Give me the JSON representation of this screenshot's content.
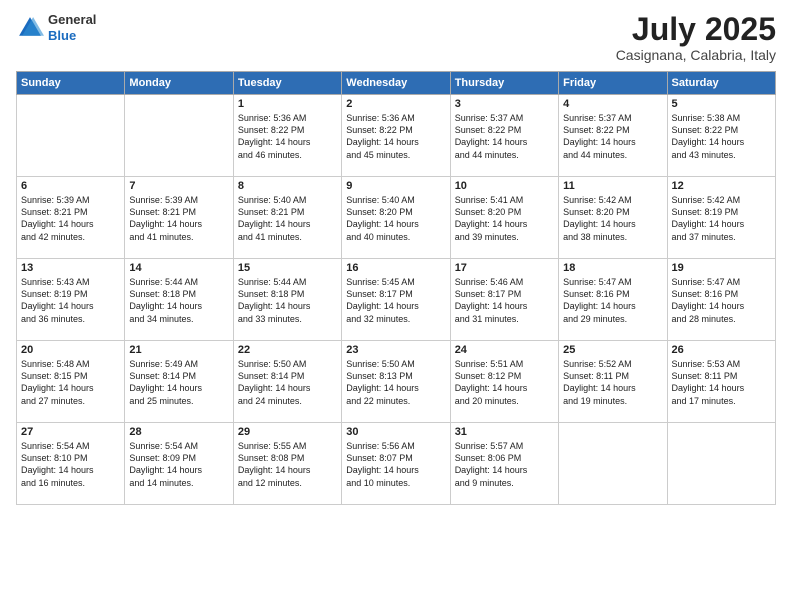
{
  "logo": {
    "general": "General",
    "blue": "Blue"
  },
  "title": {
    "month": "July 2025",
    "location": "Casignana, Calabria, Italy"
  },
  "headers": [
    "Sunday",
    "Monday",
    "Tuesday",
    "Wednesday",
    "Thursday",
    "Friday",
    "Saturday"
  ],
  "weeks": [
    [
      {
        "day": "",
        "lines": []
      },
      {
        "day": "",
        "lines": []
      },
      {
        "day": "1",
        "lines": [
          "Sunrise: 5:36 AM",
          "Sunset: 8:22 PM",
          "Daylight: 14 hours",
          "and 46 minutes."
        ]
      },
      {
        "day": "2",
        "lines": [
          "Sunrise: 5:36 AM",
          "Sunset: 8:22 PM",
          "Daylight: 14 hours",
          "and 45 minutes."
        ]
      },
      {
        "day": "3",
        "lines": [
          "Sunrise: 5:37 AM",
          "Sunset: 8:22 PM",
          "Daylight: 14 hours",
          "and 44 minutes."
        ]
      },
      {
        "day": "4",
        "lines": [
          "Sunrise: 5:37 AM",
          "Sunset: 8:22 PM",
          "Daylight: 14 hours",
          "and 44 minutes."
        ]
      },
      {
        "day": "5",
        "lines": [
          "Sunrise: 5:38 AM",
          "Sunset: 8:22 PM",
          "Daylight: 14 hours",
          "and 43 minutes."
        ]
      }
    ],
    [
      {
        "day": "6",
        "lines": [
          "Sunrise: 5:39 AM",
          "Sunset: 8:21 PM",
          "Daylight: 14 hours",
          "and 42 minutes."
        ]
      },
      {
        "day": "7",
        "lines": [
          "Sunrise: 5:39 AM",
          "Sunset: 8:21 PM",
          "Daylight: 14 hours",
          "and 41 minutes."
        ]
      },
      {
        "day": "8",
        "lines": [
          "Sunrise: 5:40 AM",
          "Sunset: 8:21 PM",
          "Daylight: 14 hours",
          "and 41 minutes."
        ]
      },
      {
        "day": "9",
        "lines": [
          "Sunrise: 5:40 AM",
          "Sunset: 8:20 PM",
          "Daylight: 14 hours",
          "and 40 minutes."
        ]
      },
      {
        "day": "10",
        "lines": [
          "Sunrise: 5:41 AM",
          "Sunset: 8:20 PM",
          "Daylight: 14 hours",
          "and 39 minutes."
        ]
      },
      {
        "day": "11",
        "lines": [
          "Sunrise: 5:42 AM",
          "Sunset: 8:20 PM",
          "Daylight: 14 hours",
          "and 38 minutes."
        ]
      },
      {
        "day": "12",
        "lines": [
          "Sunrise: 5:42 AM",
          "Sunset: 8:19 PM",
          "Daylight: 14 hours",
          "and 37 minutes."
        ]
      }
    ],
    [
      {
        "day": "13",
        "lines": [
          "Sunrise: 5:43 AM",
          "Sunset: 8:19 PM",
          "Daylight: 14 hours",
          "and 36 minutes."
        ]
      },
      {
        "day": "14",
        "lines": [
          "Sunrise: 5:44 AM",
          "Sunset: 8:18 PM",
          "Daylight: 14 hours",
          "and 34 minutes."
        ]
      },
      {
        "day": "15",
        "lines": [
          "Sunrise: 5:44 AM",
          "Sunset: 8:18 PM",
          "Daylight: 14 hours",
          "and 33 minutes."
        ]
      },
      {
        "day": "16",
        "lines": [
          "Sunrise: 5:45 AM",
          "Sunset: 8:17 PM",
          "Daylight: 14 hours",
          "and 32 minutes."
        ]
      },
      {
        "day": "17",
        "lines": [
          "Sunrise: 5:46 AM",
          "Sunset: 8:17 PM",
          "Daylight: 14 hours",
          "and 31 minutes."
        ]
      },
      {
        "day": "18",
        "lines": [
          "Sunrise: 5:47 AM",
          "Sunset: 8:16 PM",
          "Daylight: 14 hours",
          "and 29 minutes."
        ]
      },
      {
        "day": "19",
        "lines": [
          "Sunrise: 5:47 AM",
          "Sunset: 8:16 PM",
          "Daylight: 14 hours",
          "and 28 minutes."
        ]
      }
    ],
    [
      {
        "day": "20",
        "lines": [
          "Sunrise: 5:48 AM",
          "Sunset: 8:15 PM",
          "Daylight: 14 hours",
          "and 27 minutes."
        ]
      },
      {
        "day": "21",
        "lines": [
          "Sunrise: 5:49 AM",
          "Sunset: 8:14 PM",
          "Daylight: 14 hours",
          "and 25 minutes."
        ]
      },
      {
        "day": "22",
        "lines": [
          "Sunrise: 5:50 AM",
          "Sunset: 8:14 PM",
          "Daylight: 14 hours",
          "and 24 minutes."
        ]
      },
      {
        "day": "23",
        "lines": [
          "Sunrise: 5:50 AM",
          "Sunset: 8:13 PM",
          "Daylight: 14 hours",
          "and 22 minutes."
        ]
      },
      {
        "day": "24",
        "lines": [
          "Sunrise: 5:51 AM",
          "Sunset: 8:12 PM",
          "Daylight: 14 hours",
          "and 20 minutes."
        ]
      },
      {
        "day": "25",
        "lines": [
          "Sunrise: 5:52 AM",
          "Sunset: 8:11 PM",
          "Daylight: 14 hours",
          "and 19 minutes."
        ]
      },
      {
        "day": "26",
        "lines": [
          "Sunrise: 5:53 AM",
          "Sunset: 8:11 PM",
          "Daylight: 14 hours",
          "and 17 minutes."
        ]
      }
    ],
    [
      {
        "day": "27",
        "lines": [
          "Sunrise: 5:54 AM",
          "Sunset: 8:10 PM",
          "Daylight: 14 hours",
          "and 16 minutes."
        ]
      },
      {
        "day": "28",
        "lines": [
          "Sunrise: 5:54 AM",
          "Sunset: 8:09 PM",
          "Daylight: 14 hours",
          "and 14 minutes."
        ]
      },
      {
        "day": "29",
        "lines": [
          "Sunrise: 5:55 AM",
          "Sunset: 8:08 PM",
          "Daylight: 14 hours",
          "and 12 minutes."
        ]
      },
      {
        "day": "30",
        "lines": [
          "Sunrise: 5:56 AM",
          "Sunset: 8:07 PM",
          "Daylight: 14 hours",
          "and 10 minutes."
        ]
      },
      {
        "day": "31",
        "lines": [
          "Sunrise: 5:57 AM",
          "Sunset: 8:06 PM",
          "Daylight: 14 hours",
          "and 9 minutes."
        ]
      },
      {
        "day": "",
        "lines": []
      },
      {
        "day": "",
        "lines": []
      }
    ]
  ]
}
